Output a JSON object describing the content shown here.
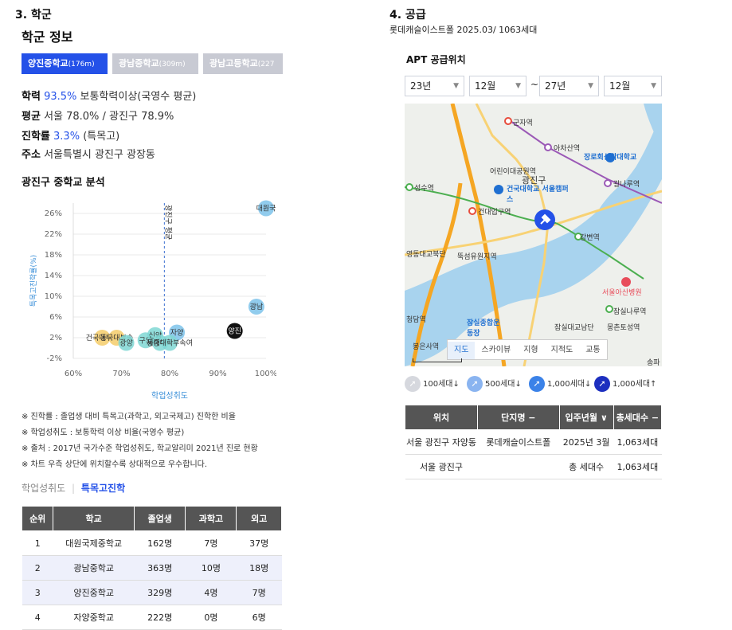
{
  "left": {
    "section_title": "3. 학군",
    "school_info_title": "학군 정보",
    "tabs": [
      {
        "name": "양진중학교",
        "dist": "(176m)",
        "active": true
      },
      {
        "name": "광남중학교",
        "dist": "(309m)",
        "active": false
      },
      {
        "name": "광남고등학교",
        "dist": "(227",
        "active": false
      }
    ],
    "stats": {
      "academic_label": "학력",
      "academic_value": "93.5%",
      "academic_desc": "보통학력이상(국영수 평균)",
      "avg_label": "평균",
      "avg_value": "서울 78.0% / 광진구 78.9%",
      "advance_label": "진학률",
      "advance_value": "3.3%",
      "advance_desc": "(특목고)",
      "addr_label": "주소",
      "addr_value": "서울특별시 광진구 광장동"
    },
    "analysis_title": "광진구 중학교 분석",
    "notes": [
      "※ 진학률 : 졸업생 대비 특목고(과학고, 외고국제고) 진학한 비율",
      "※ 학업성취도 : 보통학력 이상 비율(국영수 평균)",
      "※ 출처 : 2017년 국가수준 학업성취도, 학교알리미 2021년 진로 현황",
      "※ 차트 우측 상단에 위치할수록 상대적으로 우수합니다."
    ],
    "toggle": {
      "a": "학업성취도",
      "b": "특목고진학"
    },
    "table": {
      "headers": [
        "순위",
        "학교",
        "졸업생",
        "과학고",
        "외고"
      ],
      "rows": [
        [
          "1",
          "대원국제중학교",
          "162명",
          "7명",
          "37명"
        ],
        [
          "2",
          "광남중학교",
          "363명",
          "10명",
          "18명"
        ],
        [
          "3",
          "양진중학교",
          "329명",
          "4명",
          "7명"
        ],
        [
          "4",
          "자양중학교",
          "222명",
          "0명",
          "6명"
        ]
      ]
    }
  },
  "chart_data": {
    "type": "scatter",
    "xlabel": "학업성취도",
    "ylabel": "특목고진학률(%)",
    "xlim": [
      60,
      100
    ],
    "ylim": [
      -2,
      28
    ],
    "x_ticks": [
      "60%",
      "70%",
      "80%",
      "90%",
      "100%"
    ],
    "y_ticks": [
      "-2%",
      "2%",
      "6%",
      "10%",
      "14%",
      "18%",
      "22%",
      "26%"
    ],
    "x_tick_values": [
      60,
      70,
      80,
      90,
      100
    ],
    "y_tick_values": [
      -2,
      2,
      6,
      10,
      14,
      18,
      22,
      26
    ],
    "reference_line": {
      "x": 78.9,
      "label": "광진구 평균"
    },
    "points": [
      {
        "label": "대원국",
        "x": 100,
        "y": 27,
        "color": "#7ec3ea",
        "text_color": "#333",
        "dark": false
      },
      {
        "label": "광남",
        "x": 98,
        "y": 8,
        "color": "#7ec3ea",
        "text_color": "#333",
        "dark": false
      },
      {
        "label": "양진",
        "x": 93.5,
        "y": 3.3,
        "color": "#111111",
        "text_color": "#ffffff",
        "dark": true
      },
      {
        "label": "자양",
        "x": 81.5,
        "y": 3,
        "color": "#7ec3ea",
        "text_color": "#333",
        "dark": false
      },
      {
        "label": "건국대부속",
        "x": 66,
        "y": 2,
        "color": "#f4cd6a",
        "text_color": "#333",
        "dark": false
      },
      {
        "label": "동국대부속",
        "x": 69,
        "y": 2,
        "color": "#f4cd6a",
        "text_color": "#333",
        "dark": false
      },
      {
        "label": "광양",
        "x": 71,
        "y": 1,
        "color": "#7fd7d3",
        "text_color": "#333",
        "dark": false
      },
      {
        "label": "구의",
        "x": 75,
        "y": 1.5,
        "color": "#7fd7d3",
        "text_color": "#333",
        "dark": false
      },
      {
        "label": "신양",
        "x": 77,
        "y": 2.5,
        "color": "#7fd7d3",
        "text_color": "#333",
        "dark": false
      },
      {
        "label": "동대부속",
        "x": 78,
        "y": 1,
        "color": "#7fd7d3",
        "text_color": "#333",
        "dark": false
      },
      {
        "label": "세종대학부속여",
        "x": 80,
        "y": 1,
        "color": "#7fd7d3",
        "text_color": "#333",
        "dark": false
      }
    ]
  },
  "right": {
    "section_title": "4. 공급",
    "subtitle": "롯데캐슬이스트폴 2025.03/ 1063세대",
    "apt_title": "APT 공급위치",
    "selects": {
      "y1": "23년",
      "m1": "12월",
      "tilde": "~",
      "y2": "27년",
      "m2": "12월"
    },
    "map_labels": [
      {
        "t": "군자역",
        "cls": ""
      },
      {
        "t": "아차산역",
        "cls": ""
      },
      {
        "t": "어린이대공원역",
        "cls": ""
      },
      {
        "t": "광진구",
        "cls": ""
      },
      {
        "t": "장로회신학대학교",
        "cls": "blue2"
      },
      {
        "t": "성수역",
        "cls": ""
      },
      {
        "t": "건국대학교 서울캠퍼스",
        "cls": "blue2"
      },
      {
        "t": "광나루역",
        "cls": ""
      },
      {
        "t": "건대입구역",
        "cls": ""
      },
      {
        "t": "강변역",
        "cls": ""
      },
      {
        "t": "뚝섬유원지역",
        "cls": ""
      },
      {
        "t": "서울아산병원",
        "cls": ""
      },
      {
        "t": "잠실종합운동장",
        "cls": "blue2"
      },
      {
        "t": "잠실대교남단",
        "cls": ""
      },
      {
        "t": "몽촌토성역",
        "cls": ""
      },
      {
        "t": "잠실나루역",
        "cls": ""
      },
      {
        "t": "영동대교북단",
        "cls": ""
      },
      {
        "t": "청담역",
        "cls": ""
      },
      {
        "t": "봉은사역",
        "cls": ""
      },
      {
        "t": "송파",
        "cls": ""
      }
    ],
    "map_buttons": [
      "지도",
      "스카이뷰",
      "지형",
      "지적도",
      "교통"
    ],
    "legend": [
      "100세대↓",
      "500세대↓",
      "1,000세대↓",
      "1,000세대↑"
    ],
    "table": {
      "headers": [
        "위치",
        "단지명 −",
        "입주년월 ∨",
        "총세대수 −"
      ],
      "rows": [
        [
          "서울 광진구 자양동",
          "롯데캐슬이스트폴",
          "2025년 3월",
          "1,063세대"
        ],
        [
          "서울 광진구",
          "",
          "총 세대수",
          "1,063세대"
        ]
      ]
    },
    "colors": {
      "accent": "#2451e8",
      "header": "#555555",
      "river": "#a8d3ee"
    }
  }
}
